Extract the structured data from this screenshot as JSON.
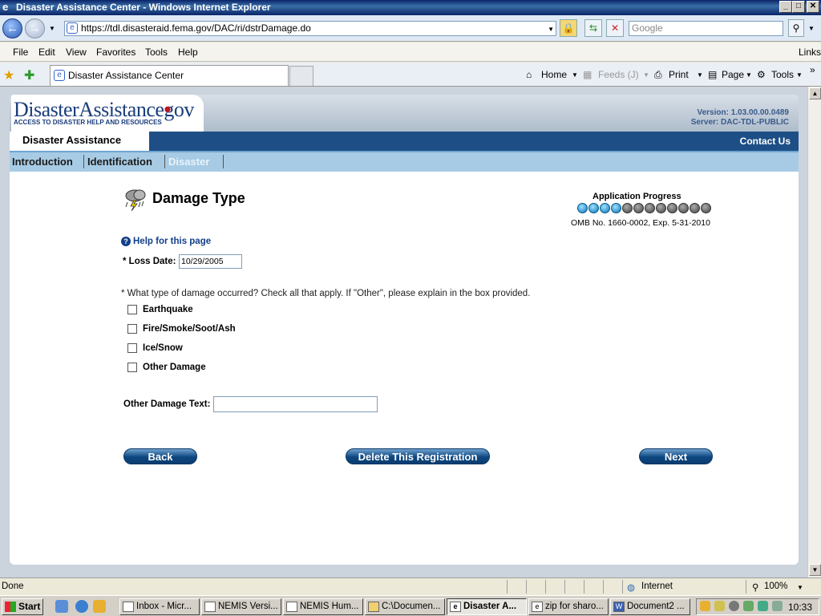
{
  "window": {
    "title": "Disaster Assistance Center - Windows Internet Explorer",
    "minimize": "_",
    "maximize": "□",
    "close": "✕"
  },
  "address": {
    "url": "https://tdl.disasteraid.fema.gov/DAC/ri/dstrDamage.do",
    "search_placeholder": "Google"
  },
  "menu": [
    "File",
    "Edit",
    "View",
    "Favorites",
    "Tools",
    "Help"
  ],
  "menu_links": "Links",
  "tab": {
    "title": "Disaster Assistance Center"
  },
  "toolbar": {
    "home": "Home",
    "feeds": "Feeds (J)",
    "print": "Print",
    "page": "Page",
    "tools": "Tools"
  },
  "site": {
    "logo_main": "DisasterAssistance",
    "logo_dot": "•",
    "logo_gov": "gov",
    "logo_tagline": "ACCESS TO DISASTER HELP AND RESOURCES",
    "version": "Version: 1.03.00.00.0489",
    "server": "Server: DAC-TDL-PUBLIC",
    "section_tab": "Disaster Assistance",
    "contact": "Contact Us",
    "subnav": [
      "Introduction",
      "Identification",
      "Disaster"
    ]
  },
  "form": {
    "title": "Damage Type",
    "progress_label": "Application Progress",
    "progress": {
      "completed": 4,
      "total": 12
    },
    "omb": "OMB No. 1660-0002, Exp. 5-31-2010",
    "help": "Help for this page",
    "loss_date_label": "* Loss Date:",
    "loss_date_value": "10/29/2005",
    "question": "* What type of damage occurred? Check all that apply. If \"Other\", please explain in the box provided.",
    "options": [
      "Earthquake",
      "Fire/Smoke/Soot/Ash",
      "Ice/Snow",
      "Other Damage"
    ],
    "other_label": "Other Damage Text:",
    "other_value": "",
    "back": "Back",
    "delete": "Delete This Registration",
    "next": "Next"
  },
  "status": {
    "left": "Done",
    "zone": "Internet",
    "zoom": "100%"
  },
  "taskbar": {
    "start": "Start",
    "tasks": [
      "Inbox - Micr...",
      "NEMIS Versi...",
      "NEMIS Hum...",
      "C:\\Documen...",
      "Disaster A...",
      "zip for sharo...",
      "Document2 ..."
    ],
    "clock": "10:33"
  }
}
